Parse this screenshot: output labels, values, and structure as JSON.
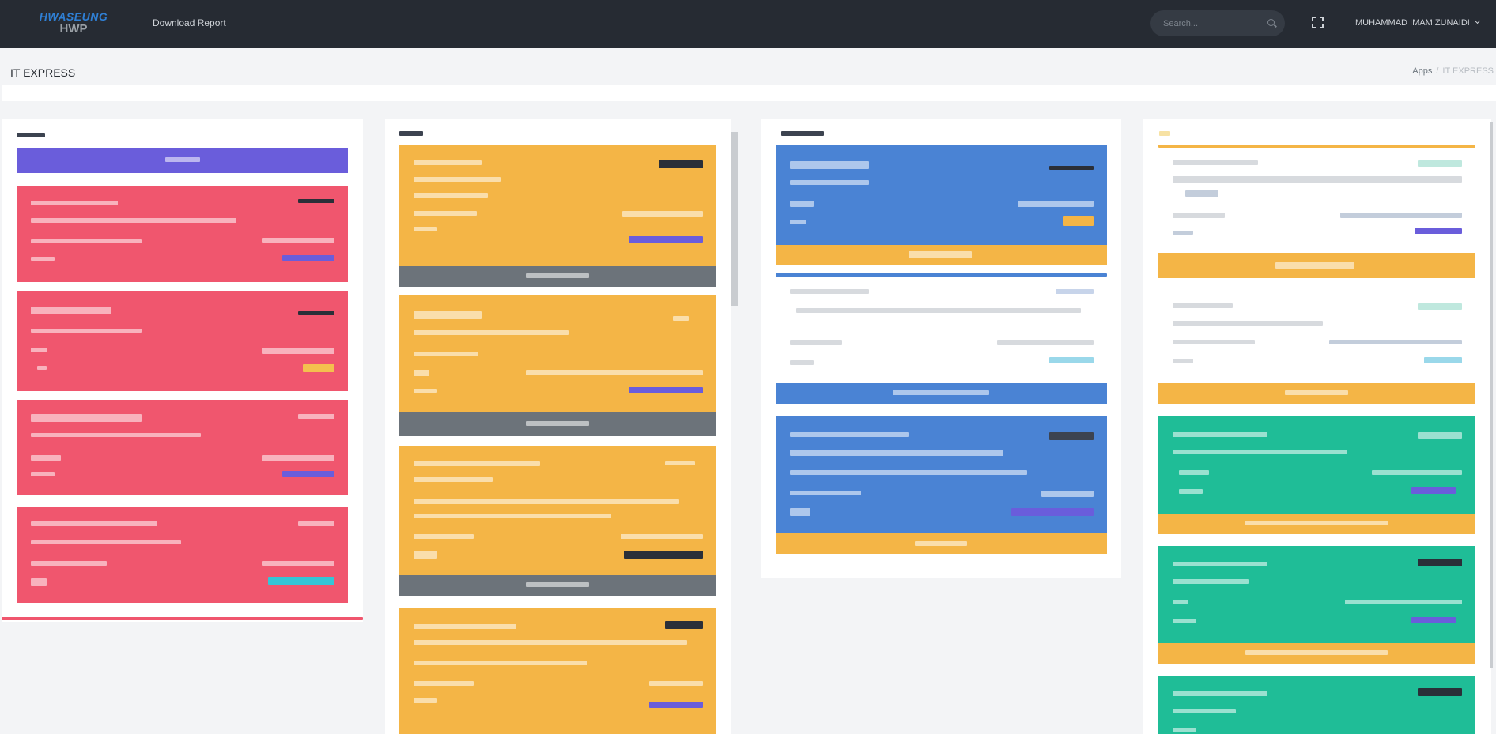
{
  "brand": {
    "line1": "HWASEUNG",
    "line2": "HWP"
  },
  "nav": {
    "download_report": "Download Report"
  },
  "search": {
    "placeholder": "Search..."
  },
  "user": {
    "name": "MUHAMMAD IMAM ZUNAIDI"
  },
  "page": {
    "title": "IT EXPRESS"
  },
  "breadcrumb": {
    "items": [
      "Apps",
      "IT EXPRESS"
    ]
  },
  "colors": {
    "topbar": "#262b33",
    "red": "#f0566e",
    "yellow": "#f4b546",
    "blue": "#4a83d4",
    "green": "#1fbd97",
    "purple": "#6a5ddb",
    "gray": "#6c737a"
  },
  "icons": {
    "search": "search-icon",
    "fullscreen": "fullscreen-icon",
    "user_menu": "chevron-down-icon"
  }
}
